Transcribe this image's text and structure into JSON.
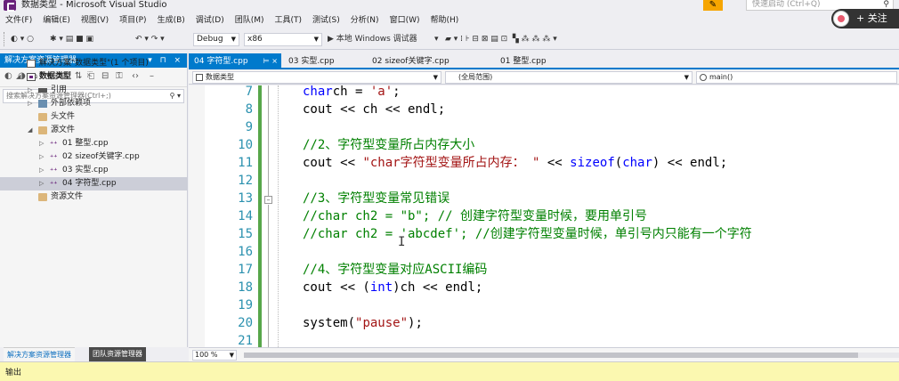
{
  "window": {
    "title": "数据类型 - Microsoft Visual Studio",
    "notify": "✎",
    "quick_launch_placeholder": "快速启动 (Ctrl+Q)"
  },
  "follow_button": "+ 关注",
  "menu": [
    "文件(F)",
    "编辑(E)",
    "视图(V)",
    "项目(P)",
    "生成(B)",
    "调试(D)",
    "团队(M)",
    "工具(T)",
    "测试(S)",
    "分析(N)",
    "窗口(W)",
    "帮助(H)"
  ],
  "toolbar": {
    "config": "Debug",
    "platform": "x86",
    "run_label": "▶ 本地 Windows 调试器"
  },
  "solution_explorer": {
    "title": "解决方案资源管理器",
    "controls": "▾ ⊓ ×",
    "search_placeholder": "搜索解决方案资源管理器(Ctrl+;)",
    "tree": [
      {
        "label": "解决方案\"数据类型\"(1 个项目)",
        "icon": "solution-icon",
        "level": 0,
        "expander": ""
      },
      {
        "label": "数据类型",
        "icon": "project-icon",
        "level": 0,
        "expander": "◢",
        "bold": true
      },
      {
        "label": "引用",
        "icon": "references-icon",
        "level": 1,
        "expander": "▷"
      },
      {
        "label": "外部依赖项",
        "icon": "dependencies-icon",
        "level": 1,
        "expander": "▷"
      },
      {
        "label": "头文件",
        "icon": "folder-icon",
        "level": 1,
        "expander": ""
      },
      {
        "label": "源文件",
        "icon": "folder-icon",
        "level": 1,
        "expander": "◢"
      },
      {
        "label": "01 整型.cpp",
        "icon": "cpp-file-icon",
        "level": 2,
        "expander": "▷"
      },
      {
        "label": "02 sizeof关键字.cpp",
        "icon": "cpp-file-icon",
        "level": 2,
        "expander": "▷"
      },
      {
        "label": "03 实型.cpp",
        "icon": "cpp-file-icon",
        "level": 2,
        "expander": "▷"
      },
      {
        "label": "04 字符型.cpp",
        "icon": "cpp-file-icon",
        "level": 2,
        "expander": "▷",
        "selected": true
      },
      {
        "label": "资源文件",
        "icon": "folder-icon",
        "level": 1,
        "expander": ""
      }
    ],
    "bottom_tabs": [
      "解决方案资源管理器",
      "团队资源管理器"
    ]
  },
  "editor_tabs": [
    {
      "label": "04 字符型.cpp",
      "pin": "⊨ ×",
      "active": true
    },
    {
      "label": "03 实型.cpp",
      "pin": "",
      "active": false
    },
    {
      "label": "02 sizeof关键字.cpp",
      "pin": "",
      "active": false
    },
    {
      "label": "01 整型.cpp",
      "pin": "",
      "active": false
    }
  ],
  "navbar": {
    "project": "数据类型",
    "scope": "(全局范围)",
    "member": "main()"
  },
  "code_lines": [
    {
      "n": "7",
      "tokens": [
        [
          "kw",
          "char"
        ],
        [
          "",
          "ch = "
        ],
        [
          "st",
          "'a'"
        ],
        [
          "",
          ";"
        ]
      ]
    },
    {
      "n": "8",
      "tokens": [
        [
          "",
          "cout << ch << endl;"
        ]
      ]
    },
    {
      "n": "9",
      "tokens": []
    },
    {
      "n": "10",
      "tokens": [
        [
          "cm",
          "//2、字符型变量所占内存大小"
        ]
      ]
    },
    {
      "n": "11",
      "tokens": [
        [
          "",
          "cout << "
        ],
        [
          "st",
          "\"char字符型变量所占内存： \""
        ],
        [
          "",
          " << "
        ],
        [
          "kw",
          "sizeof"
        ],
        [
          "",
          "("
        ],
        [
          "kw",
          "char"
        ],
        [
          "",
          ") << endl;"
        ]
      ]
    },
    {
      "n": "12",
      "tokens": []
    },
    {
      "n": "13",
      "tokens": [
        [
          "cm",
          "//3、字符型变量常见错误"
        ]
      ]
    },
    {
      "n": "14",
      "tokens": [
        [
          "cm",
          "//char ch2 = \"b\"; // 创建字符型变量时候，要用单引号"
        ]
      ]
    },
    {
      "n": "15",
      "tokens": [
        [
          "cm",
          "//char ch2 = 'abcdef'; //创建字符型变量时候，单引号内只能有一个字符"
        ]
      ]
    },
    {
      "n": "16",
      "tokens": []
    },
    {
      "n": "17",
      "tokens": [
        [
          "cm",
          "//4、字符型变量对应ASCII编码"
        ]
      ]
    },
    {
      "n": "18",
      "tokens": [
        [
          "",
          "cout << ("
        ],
        [
          "kw",
          "int"
        ],
        [
          "",
          ")ch << endl;"
        ]
      ]
    },
    {
      "n": "19",
      "tokens": []
    },
    {
      "n": "20",
      "tokens": [
        [
          "",
          "system("
        ],
        [
          "st",
          "\"pause\""
        ],
        [
          "",
          ");"
        ]
      ]
    },
    {
      "n": "21",
      "tokens": []
    }
  ],
  "zoom": "100 %",
  "output_label": "输出"
}
